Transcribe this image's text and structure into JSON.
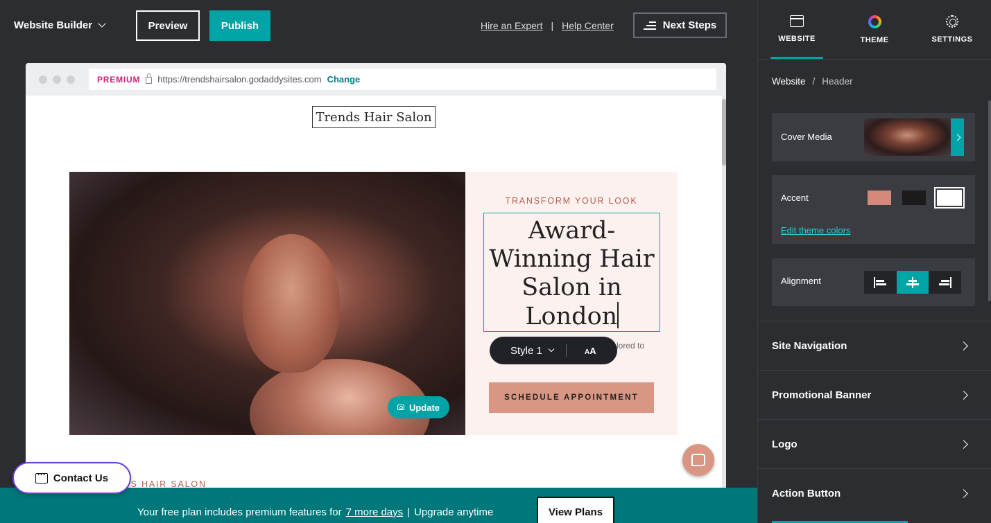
{
  "topbar": {
    "builder_label": "Website Builder",
    "preview_label": "Preview",
    "publish_label": "Publish",
    "hire_expert": "Hire an Expert",
    "separator": "|",
    "help_center": "Help Center",
    "next_steps": "Next Steps"
  },
  "browser": {
    "premium_badge": "PREMIUM",
    "url": "https://trendshairsalon.godaddysites.com",
    "change_label": "Change"
  },
  "site": {
    "logo_text": "Trends Hair Salon",
    "eyebrow": "TRANSFORM YOUR LOOK",
    "headline_lines": [
      "Award-",
      "Winning Hair",
      "Salon in",
      "London"
    ],
    "subtext_fragment": "lored to",
    "style_selector": "Style 1",
    "text_size_icon": "text-size-icon",
    "schedule_button": "SCHEDULE APPOINTMENT",
    "update_button": "Update",
    "footer_fragment": "NDS HAIR SALON"
  },
  "contact": {
    "label": "Contact Us"
  },
  "banner": {
    "text_before": "Your free plan includes premium features for",
    "link": "7 more days",
    "separator": "|",
    "text_after": "Upgrade anytime",
    "button": "View Plans"
  },
  "panel": {
    "tabs": [
      {
        "label": "WEBSITE",
        "icon": "website-icon",
        "active": true
      },
      {
        "label": "THEME",
        "icon": "theme-icon",
        "active": false
      },
      {
        "label": "SETTINGS",
        "icon": "gear-icon",
        "active": false
      }
    ],
    "breadcrumb": {
      "root": "Website",
      "sep": "/",
      "current": "Header"
    },
    "cover_media_label": "Cover Media",
    "accent_label": "Accent",
    "accent_colors": [
      "#d4897a",
      "#1c1a1b",
      "#ffffff"
    ],
    "edit_theme_colors": "Edit theme colors",
    "alignment_label": "Alignment",
    "alignment_selected": "center",
    "nav_rows": [
      "Site Navigation",
      "Promotional Banner",
      "Logo",
      "Action Button"
    ]
  },
  "colors": {
    "accent_teal": "#00a4a6",
    "banner_teal": "#00777a",
    "salmon": "#d99783",
    "premium_pink": "#d81b7a"
  }
}
